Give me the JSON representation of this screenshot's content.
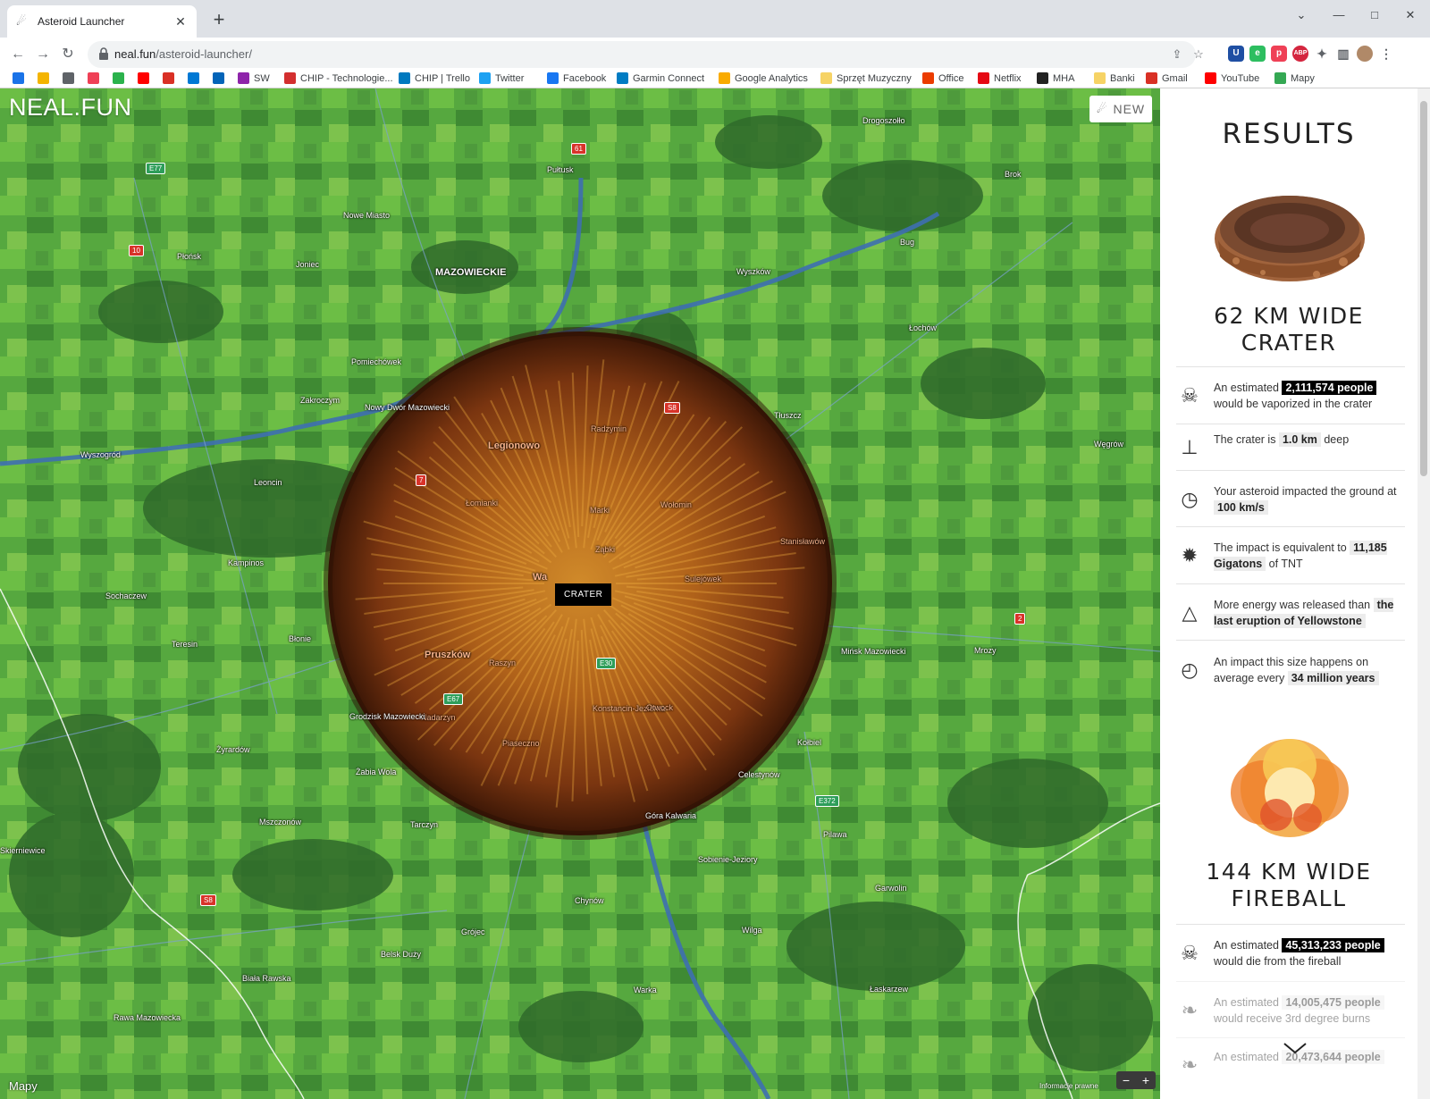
{
  "browser": {
    "tab_title": "Asteroid Launcher",
    "url_host": "neal.fun",
    "url_path": "/asteroid-launcher/",
    "bookmarks": [
      {
        "label": "",
        "icon": "calendar-icon",
        "color": "#1a73e8"
      },
      {
        "label": "",
        "icon": "keep-icon",
        "color": "#f4b400"
      },
      {
        "label": "",
        "icon": "globe-icon",
        "color": "#5f6368"
      },
      {
        "label": "",
        "icon": "pocket-icon",
        "color": "#ef4056"
      },
      {
        "label": "",
        "icon": "feedly-icon",
        "color": "#2bb24c"
      },
      {
        "label": "",
        "icon": "youtube-icon",
        "color": "#ff0000"
      },
      {
        "label": "",
        "icon": "gmail-icon",
        "color": "#d93025"
      },
      {
        "label": "",
        "icon": "outlook-icon",
        "color": "#0078d4"
      },
      {
        "label": "",
        "icon": "onedrive-icon",
        "color": "#0364b8"
      },
      {
        "label": "SW",
        "icon": "sw-icon",
        "color": "#8e24aa"
      },
      {
        "label": "CHIP - Technologie...",
        "icon": "chip-icon",
        "color": "#d32f2f"
      },
      {
        "label": "CHIP | Trello",
        "icon": "trello-icon",
        "color": "#0079bf"
      },
      {
        "label": "Twitter",
        "icon": "twitter-icon",
        "color": "#1da1f2"
      },
      {
        "label": "Facebook",
        "icon": "facebook-icon",
        "color": "#1877f2"
      },
      {
        "label": "Garmin Connect",
        "icon": "garmin-icon",
        "color": "#007cc3"
      },
      {
        "label": "Google Analytics",
        "icon": "analytics-icon",
        "color": "#f9ab00"
      },
      {
        "label": "Sprzęt Muzyczny",
        "icon": "folder-icon",
        "color": "#f6d365"
      },
      {
        "label": "Office",
        "icon": "office-icon",
        "color": "#eb3c00"
      },
      {
        "label": "Netflix",
        "icon": "netflix-icon",
        "color": "#e50914"
      },
      {
        "label": "MHA",
        "icon": "mha-icon",
        "color": "#222222"
      },
      {
        "label": "Banki",
        "icon": "folder-icon",
        "color": "#f6d365"
      },
      {
        "label": "Gmail",
        "icon": "gmail-icon",
        "color": "#d93025"
      },
      {
        "label": "YouTube",
        "icon": "youtube-icon",
        "color": "#ff0000"
      },
      {
        "label": "Mapy",
        "icon": "maps-icon",
        "color": "#34a853"
      }
    ]
  },
  "map": {
    "logo": "NEAL.FUN",
    "new_button": "NEW",
    "crater_tag": "CRATER",
    "attribution": "Mapy",
    "legal": "Informacje prawne",
    "labels": [
      {
        "text": "MAZOWIECKIE",
        "style": "big"
      },
      {
        "text": "Pułtusk"
      },
      {
        "text": "Nowe Miasto"
      },
      {
        "text": "Płońsk"
      },
      {
        "text": "Joniec"
      },
      {
        "text": "Wyszków"
      },
      {
        "text": "Brok"
      },
      {
        "text": "Drogoszołło"
      },
      {
        "text": "Łochów"
      },
      {
        "text": "Pomiechówek"
      },
      {
        "text": "Zakroczym"
      },
      {
        "text": "Nowy Dwór Mazowiecki"
      },
      {
        "text": "Wyszogród"
      },
      {
        "text": "Leoncin"
      },
      {
        "text": "Kampinos"
      },
      {
        "text": "Sochaczew"
      },
      {
        "text": "Teresin"
      },
      {
        "text": "Błonie"
      },
      {
        "text": "Legionowo",
        "style": "big-red"
      },
      {
        "text": "Radzymin",
        "style": "red"
      },
      {
        "text": "Tłuszcz"
      },
      {
        "text": "Węgrów"
      },
      {
        "text": "Łomianki",
        "style": "red"
      },
      {
        "text": "Marki",
        "style": "red"
      },
      {
        "text": "Wołomin",
        "style": "red"
      },
      {
        "text": "Ząbki",
        "style": "red"
      },
      {
        "text": "Stanisławów",
        "style": "red"
      },
      {
        "text": "Wa",
        "style": "big-red"
      },
      {
        "text": "Sulejówek",
        "style": "red"
      },
      {
        "text": "Mińsk Mazowiecki"
      },
      {
        "text": "Mrozy"
      },
      {
        "text": "Pruszków",
        "style": "big-red"
      },
      {
        "text": "Raszyn",
        "style": "red"
      },
      {
        "text": "Nadarzyn",
        "style": "red"
      },
      {
        "text": "Konstancin-Jeziorna",
        "style": "red"
      },
      {
        "text": "Otwock",
        "style": "red"
      },
      {
        "text": "Piaseczno",
        "style": "red"
      },
      {
        "text": "Grodzisk Mazowiecki"
      },
      {
        "text": "Żyrardów"
      },
      {
        "text": "Żabia Wola"
      },
      {
        "text": "Kołbiel"
      },
      {
        "text": "Celestynów"
      },
      {
        "text": "Mszczonów"
      },
      {
        "text": "Tarczyn"
      },
      {
        "text": "Góra Kalwaria"
      },
      {
        "text": "Pilawa"
      },
      {
        "text": "Skierniewice"
      },
      {
        "text": "Sobienie-Jeziory"
      },
      {
        "text": "Garwolin"
      },
      {
        "text": "Chynów"
      },
      {
        "text": "Grójec"
      },
      {
        "text": "Wilga"
      },
      {
        "text": "Belsk Duży"
      },
      {
        "text": "Biała Rawska"
      },
      {
        "text": "Warka"
      },
      {
        "text": "Łaskarzew"
      },
      {
        "text": "Rawa Mazowiecka"
      },
      {
        "text": "Bug"
      }
    ],
    "road_badges": [
      {
        "text": "E77",
        "style": "green"
      },
      {
        "text": "61"
      },
      {
        "text": "10"
      },
      {
        "text": "S8"
      },
      {
        "text": "7"
      },
      {
        "text": "2"
      },
      {
        "text": "E67",
        "style": "green"
      },
      {
        "text": "E30",
        "style": "green"
      },
      {
        "text": "E372",
        "style": "green"
      },
      {
        "text": "S8"
      },
      {
        "text": "E77",
        "style": "green"
      }
    ]
  },
  "results": {
    "title": "RESULTS",
    "crater": {
      "heading_line1": "62 KM WIDE",
      "heading_line2": "CRATER",
      "stats": [
        {
          "icon": "skull-icon",
          "pre": "An estimated",
          "value": "2,111,574 people",
          "post": "would be vaporized in the crater",
          "style": "black"
        },
        {
          "icon": "depth-icon",
          "pre": "The crater is",
          "value": "1.0 km",
          "post": "deep",
          "style": "grey"
        },
        {
          "icon": "speedometer-icon",
          "pre": "Your asteroid impacted the ground at",
          "value": "100 km/s",
          "post": "",
          "style": "grey"
        },
        {
          "icon": "explosion-icon",
          "pre": "The impact is equivalent to",
          "value": "11,185 Gigatons",
          "post": "of TNT",
          "style": "grey"
        },
        {
          "icon": "volcano-icon",
          "pre": "More energy was released than",
          "value": "the last eruption of Yellowstone",
          "post": "",
          "style": "grey"
        },
        {
          "icon": "clock-icon",
          "pre": "An impact this size happens on average every",
          "value": "34 million years",
          "post": "",
          "style": "grey"
        }
      ]
    },
    "fireball": {
      "heading_line1": "144 KM WIDE",
      "heading_line2": "FIREBALL",
      "stats": [
        {
          "icon": "skull-icon",
          "pre": "An estimated",
          "value": "45,313,233 people",
          "post": "would die from the fireball",
          "style": "black"
        },
        {
          "icon": "burn-icon",
          "pre": "An estimated",
          "value": "14,005,475 people",
          "post": "would receive 3rd degree burns",
          "style": "grey",
          "faded": true
        },
        {
          "icon": "burn-icon",
          "pre": "An estimated",
          "value": "20,473,644 people",
          "post": "",
          "style": "grey",
          "faded": true
        }
      ]
    }
  }
}
